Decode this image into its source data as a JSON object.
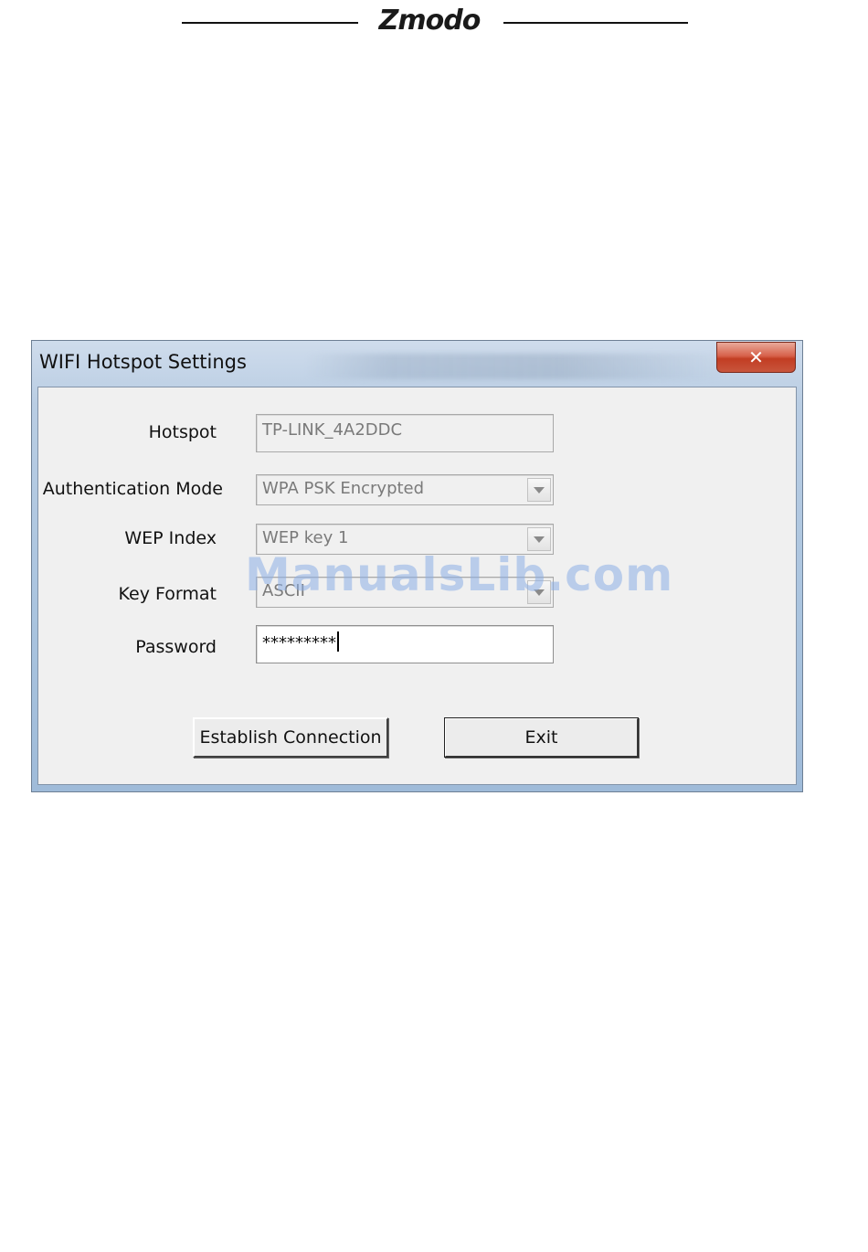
{
  "page_header": {
    "logo_text": "Zmodo"
  },
  "dialog": {
    "title": "WIFI Hotspot Settings",
    "close_glyph": "✕",
    "fields": {
      "hotspot": {
        "label": "Hotspot",
        "value": "TP-LINK_4A2DDC"
      },
      "auth_mode": {
        "label": "Authentication Mode",
        "value": "WPA PSK Encrypted"
      },
      "wep_index": {
        "label": "WEP Index",
        "value": "WEP key 1"
      },
      "key_format": {
        "label": "Key Format",
        "value": "ASCII"
      },
      "password": {
        "label": "Password",
        "value": "*********"
      }
    },
    "buttons": {
      "establish_label": "Establish  Connection",
      "exit_label": "Exit"
    }
  },
  "watermark": "ManualsLib.com",
  "colors": {
    "window_frame": "#aac4df",
    "close_button": "#c8553c",
    "client_background": "#f0f0f0",
    "watermark": "#8cafe6"
  }
}
